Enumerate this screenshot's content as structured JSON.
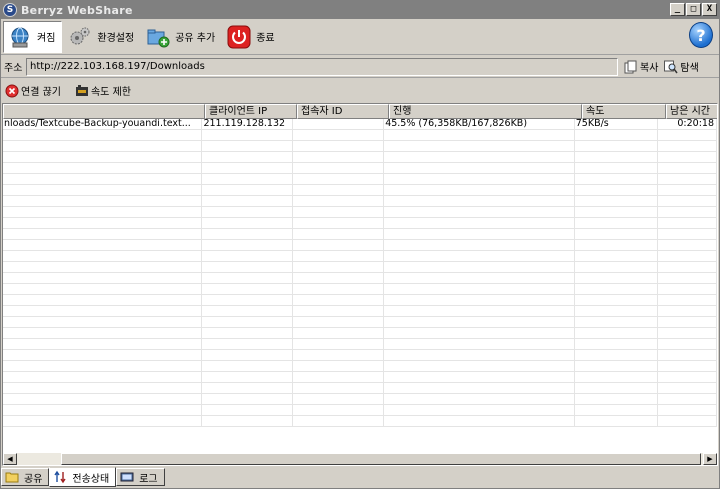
{
  "window": {
    "title": "Berryz WebShare"
  },
  "title_controls": {
    "minimize": "_",
    "maximize": "□",
    "close": "X"
  },
  "toolbar": {
    "items": [
      {
        "label": "켜짐",
        "icon": "network-icon"
      },
      {
        "label": "환경설정",
        "icon": "gears-icon"
      },
      {
        "label": "공유 추가",
        "icon": "add-share-icon"
      },
      {
        "label": "종료",
        "icon": "power-icon"
      }
    ],
    "help": "?"
  },
  "address": {
    "label": "주소",
    "value": "http://222.103.168.197/Downloads",
    "copy_label": "복사",
    "explore_label": "탐색"
  },
  "actions": {
    "disconnect_label": "연결 끊기",
    "speed_limit_label": "속도 제한"
  },
  "table": {
    "columns": [
      "",
      "클라이언트 IP",
      "접속자 ID",
      "진행",
      "속도",
      "남은 시간"
    ],
    "rows": [
      [
        "nloads/Textcube-Backup-youandi.text...",
        "211.119.128.132",
        "",
        "45.5% (76,358KB/167,826KB)",
        "75KB/s",
        "0:20:18"
      ]
    ]
  },
  "tabs": [
    {
      "label": "공유",
      "icon": "folder-icon"
    },
    {
      "label": "전송상태",
      "icon": "transfer-icon"
    },
    {
      "label": "로그",
      "icon": "log-icon"
    }
  ]
}
